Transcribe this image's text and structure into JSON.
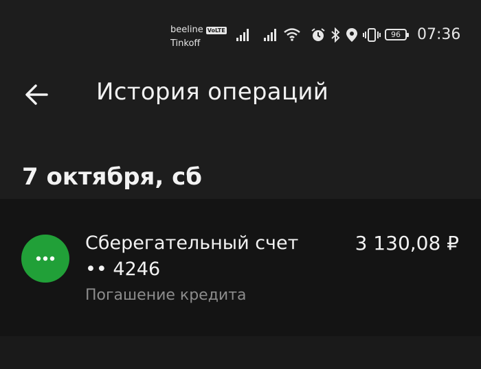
{
  "status_bar": {
    "carrier_1": "beeline",
    "volte": "VoLTE",
    "carrier_2": "Tinkoff",
    "battery": "96",
    "time": "07:36"
  },
  "header": {
    "title": "История операций"
  },
  "groups": [
    {
      "date": "7 октября, сб",
      "operations": [
        {
          "name": "Сберегательный счет •• 4246",
          "amount": "3 130,08 ₽",
          "description": "Погашение кредита",
          "avatar_icon": "more-dots-icon",
          "avatar_color": "#21a038"
        }
      ]
    }
  ],
  "colors": {
    "background": "#1a1a1a",
    "card": "#141414",
    "accent_green": "#21a038",
    "secondary_text": "#8c8c8c"
  }
}
